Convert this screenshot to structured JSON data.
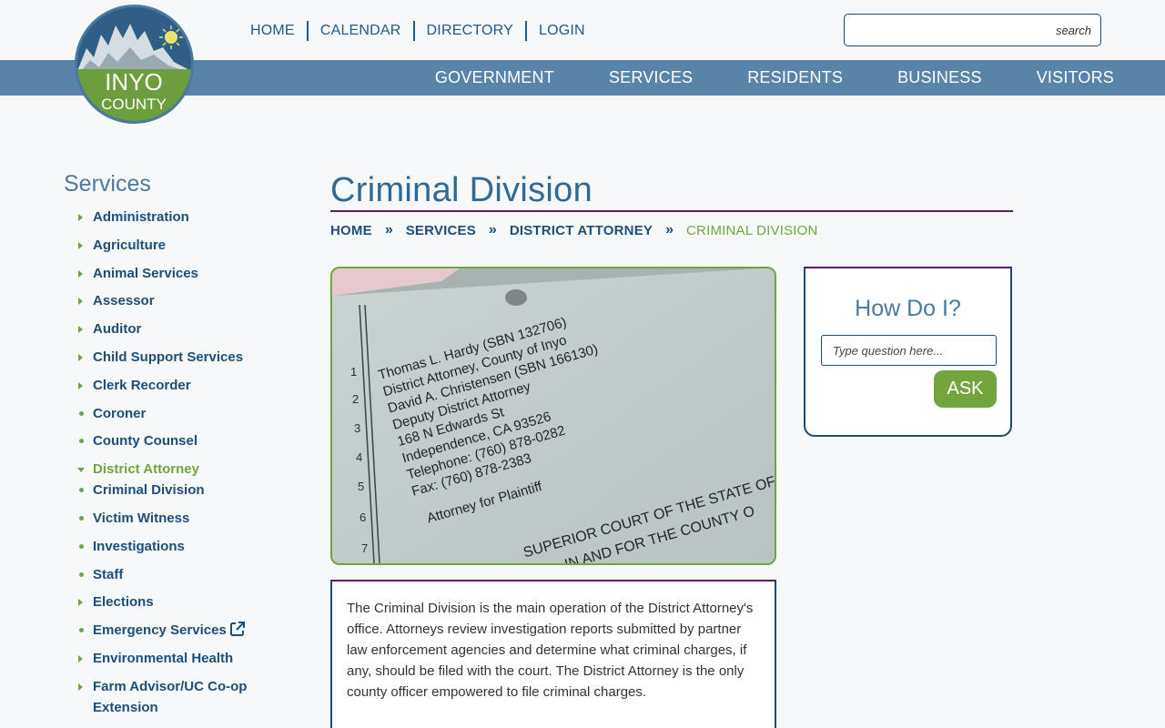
{
  "header": {
    "logo": {
      "line1": "INYO",
      "line2": "COUNTY"
    },
    "top_links": [
      "HOME",
      "CALENDAR",
      "DIRECTORY",
      "LOGIN"
    ],
    "search": {
      "placeholder": "search"
    },
    "main_nav": [
      "GOVERNMENT",
      "SERVICES",
      "RESIDENTS",
      "BUSINESS",
      "VISITORS"
    ]
  },
  "sidebar": {
    "title": "Services",
    "items": [
      {
        "label": "Administration",
        "marker": "arrow"
      },
      {
        "label": "Agriculture",
        "marker": "arrow"
      },
      {
        "label": "Animal Services",
        "marker": "arrow"
      },
      {
        "label": "Assessor",
        "marker": "arrow"
      },
      {
        "label": "Auditor",
        "marker": "arrow"
      },
      {
        "label": "Child Support Services",
        "marker": "arrow"
      },
      {
        "label": "Clerk Recorder",
        "marker": "arrow"
      },
      {
        "label": "Coroner",
        "marker": "dot"
      },
      {
        "label": "County Counsel",
        "marker": "dot"
      }
    ],
    "active_item": {
      "label": "District Attorney",
      "children": [
        "Criminal Division",
        "Victim Witness",
        "Investigations",
        "Staff"
      ]
    },
    "items_after": [
      {
        "label": "Elections",
        "marker": "arrow"
      },
      {
        "label": "Emergency Services",
        "marker": "dot"
      },
      {
        "label": "Environmental Health",
        "marker": "arrow"
      },
      {
        "label": "Farm Advisor/UC Co-op Extension",
        "marker": "arrow"
      }
    ]
  },
  "main": {
    "title": "Criminal Division",
    "breadcrumb": [
      "HOME",
      "SERVICES",
      "DISTRICT ATTORNEY"
    ],
    "breadcrumb_current": "CRIMINAL DIVISION",
    "photo_text": {
      "lines": [
        "Thomas L. Hardy (SBN 132706)",
        "District Attorney, County of Inyo",
        "David A. Christensen (SBN 166130)",
        "Deputy District Attorney",
        "168 N Edwards St",
        "Independence, CA 93526",
        "Telephone: (760) 878-0282",
        "Fax: (760) 878-2383",
        "Attorney for Plaintiff"
      ],
      "line_numbers": [
        "1",
        "2",
        "3",
        "4",
        "5",
        "6",
        "7"
      ],
      "court_line1": "SUPERIOR COURT OF THE STATE OF",
      "court_line2": "IN AND FOR THE COUNTY O"
    },
    "description": "The Criminal Division is the main operation of the District Attorney's office.  Attorneys review investigation reports submitted by partner law enforcement agencies and determine what criminal charges, if any, should be filed with the court.  The District Attorney is the only county officer empowered to file criminal charges."
  },
  "howdoi": {
    "title": "How Do I?",
    "placeholder": "Type question here...",
    "button": "ASK"
  },
  "colors": {
    "primary_blue": "#5784a8",
    "dark_blue": "#1e4e78",
    "accent_green": "#72a53d",
    "purple_rule": "#5a1f5e"
  }
}
